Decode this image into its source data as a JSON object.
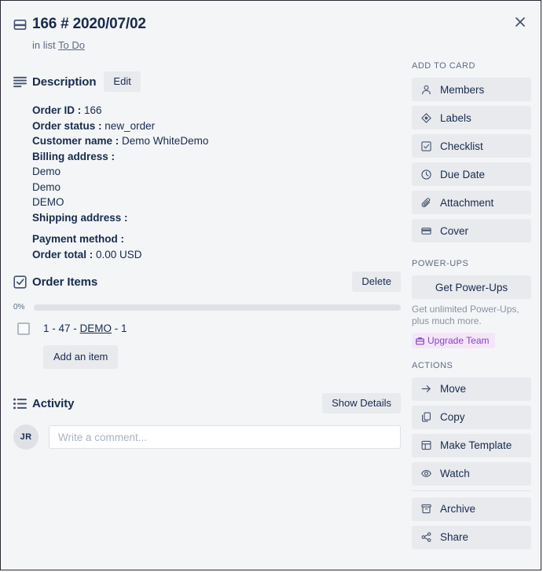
{
  "window": {
    "close_label": "×",
    "bg_color": "#f4f5f7",
    "accent_color": "#172b4d"
  },
  "header": {
    "card_icon": "card-window-icon",
    "title": "166 # 2020/07/02",
    "in_list_prefix": "in list",
    "list_name": "To Do"
  },
  "description": {
    "icon": "description-lines-icon",
    "title": "Description",
    "edit_label": "Edit",
    "fields": [
      {
        "label": "Order ID :",
        "value": "166"
      },
      {
        "label": "Order status :",
        "value": "new_order"
      },
      {
        "label": "Customer name :",
        "value": "Demo WhiteDemo"
      },
      {
        "label": "Billing address :",
        "value": ""
      }
    ],
    "address_lines": [
      "Demo",
      "Demo",
      "DEMO"
    ],
    "shipping_label": "Shipping address :",
    "shipping_value": "",
    "payment_label": "Payment method :",
    "payment_value": "",
    "total_label": "Order total :",
    "total_value": "0.00 USD"
  },
  "checklist": {
    "icon": "checklist-icon",
    "title": "Order Items",
    "delete_label": "Delete",
    "progress_text": "0%",
    "progress_value": 0,
    "items": [
      {
        "checked": false,
        "prefix": "1 - 47 - ",
        "link": "DEMO",
        "suffix": " - 1"
      }
    ],
    "add_item_label": "Add an item"
  },
  "activity": {
    "icon": "activity-list-icon",
    "title": "Activity",
    "show_details_label": "Show Details",
    "avatar_initials": "JR",
    "comment_placeholder": "Write a comment...",
    "comment_value": ""
  },
  "sidebar": {
    "add_to_card": {
      "heading": "ADD TO CARD",
      "items": [
        {
          "icon": "person-icon",
          "label": "Members"
        },
        {
          "icon": "label-tag-icon",
          "label": "Labels"
        },
        {
          "icon": "checklist-icon",
          "label": "Checklist"
        },
        {
          "icon": "clock-icon",
          "label": "Due Date"
        },
        {
          "icon": "paperclip-icon",
          "label": "Attachment"
        },
        {
          "icon": "cover-icon",
          "label": "Cover"
        }
      ]
    },
    "power_ups": {
      "heading": "POWER-UPS",
      "button_label": "Get Power-Ups",
      "note": "Get unlimited Power-Ups, plus much more.",
      "badge_icon": "briefcase-icon",
      "badge_label": "Upgrade Team",
      "badge_bg": "#f3e6fa",
      "badge_color": "#8b42c4"
    },
    "actions": {
      "heading": "ACTIONS",
      "items_primary": [
        {
          "icon": "arrow-right-icon",
          "label": "Move"
        },
        {
          "icon": "copy-icon",
          "label": "Copy"
        },
        {
          "icon": "template-icon",
          "label": "Make Template"
        },
        {
          "icon": "eye-icon",
          "label": "Watch"
        }
      ],
      "items_secondary": [
        {
          "icon": "archive-icon",
          "label": "Archive"
        },
        {
          "icon": "share-icon",
          "label": "Share"
        }
      ]
    }
  }
}
